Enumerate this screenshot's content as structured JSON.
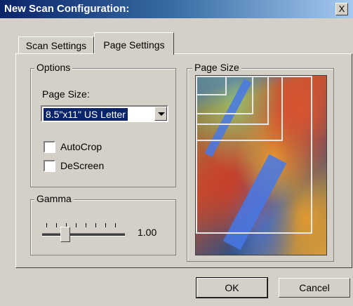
{
  "window": {
    "title": "New Scan Configuration:",
    "close_glyph": "X"
  },
  "tabs": [
    {
      "label": "Scan Settings",
      "active": false
    },
    {
      "label": "Page Settings",
      "active": true
    }
  ],
  "options_group": {
    "title": "Options",
    "page_size_label": "Page Size:",
    "page_size_value": "8.5\"x11\" US Letter",
    "autocrop": {
      "label": "AutoCrop",
      "checked": false
    },
    "descreen": {
      "label": "DeScreen",
      "checked": false
    }
  },
  "gamma_group": {
    "title": "Gamma",
    "value_text": "1.00"
  },
  "preview_group": {
    "title": "Page Size"
  },
  "buttons": {
    "ok": "OK",
    "cancel": "Cancel"
  },
  "icons": {
    "close": "close-icon",
    "dropdown": "chevron-down-icon"
  }
}
